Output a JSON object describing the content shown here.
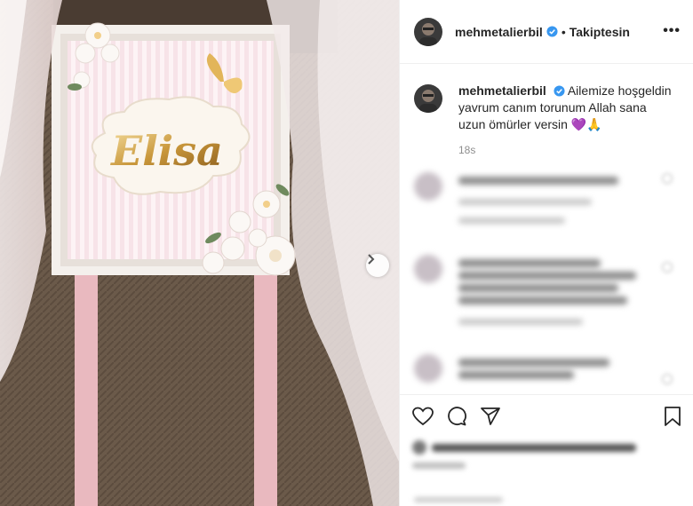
{
  "post": {
    "author": "mehmetalierbil",
    "follow_status": "Takiptesin",
    "separator": "•",
    "more": "•••"
  },
  "photo": {
    "sign_text": "Elisa"
  },
  "caption": {
    "author": "mehmetalierbil",
    "text": "Ailemize hoşgeldin yavrum canım torunum Allah sana uzun ömürler versin 💜🙏",
    "time": "18s"
  },
  "icons": {
    "like": "heart-icon",
    "comment": "comment-icon",
    "share": "share-icon",
    "save": "bookmark-icon",
    "next": "chevron-right-icon",
    "verified": "verified-badge-icon"
  },
  "colors": {
    "verified": "#3897f0",
    "text": "#262626",
    "muted": "#8e8e8e"
  }
}
